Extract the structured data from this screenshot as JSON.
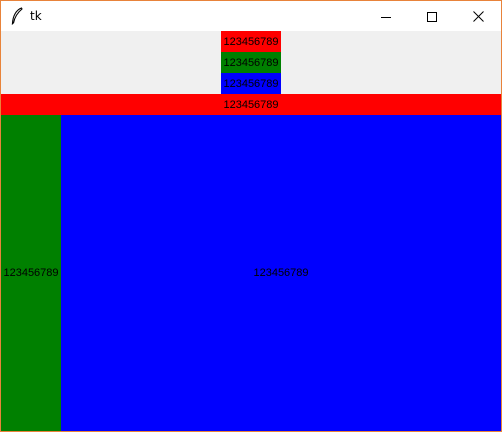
{
  "window": {
    "title": "tk",
    "border_color": "#e8833a",
    "icons": {
      "app": "feather-icon",
      "minimize": "minimize-icon",
      "maximize": "maximize-icon",
      "close": "close-icon"
    }
  },
  "labels": [
    {
      "text": "123456789",
      "bg": "#ff0000"
    },
    {
      "text": "123456789",
      "bg": "#008000"
    },
    {
      "text": "123456789",
      "bg": "#0000ff"
    },
    {
      "text": "123456789",
      "bg": "#ff0000"
    },
    {
      "text": "123456789",
      "bg": "#008000"
    },
    {
      "text": "123456789",
      "bg": "#0000ff"
    }
  ]
}
